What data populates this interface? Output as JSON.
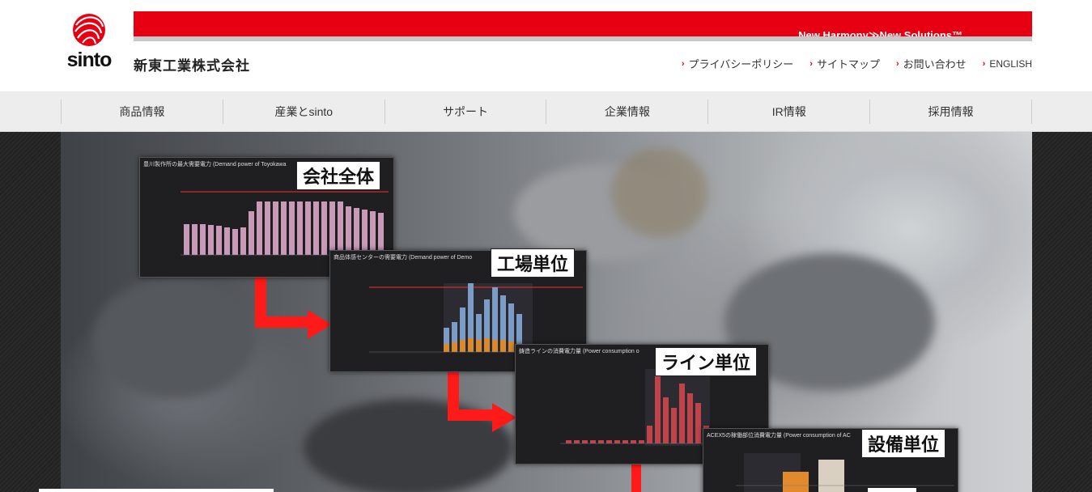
{
  "header": {
    "logo_text": "sinto",
    "company_name": "新東工業株式会社",
    "tagline": "New Harmony≫New Solutions™",
    "links": [
      {
        "label": "プライバシーポリシー"
      },
      {
        "label": "サイトマップ"
      },
      {
        "label": "お問い合わせ"
      },
      {
        "label": "ENGLISH"
      }
    ]
  },
  "nav": {
    "items": [
      {
        "label": "商品情報"
      },
      {
        "label": "産業とsinto"
      },
      {
        "label": "サポート"
      },
      {
        "label": "企業情報"
      },
      {
        "label": "IR情報"
      },
      {
        "label": "採用情報"
      }
    ]
  },
  "hero": {
    "panels": [
      {
        "title": "豊川製作所の最大需要電力 (Demand power of Toyokawa",
        "label": "会社全体"
      },
      {
        "title": "商品体感センターの需要電力 (Demand power of Demo",
        "label": "工場単位"
      },
      {
        "title": "鋳造ラインの消費電力量 (Power consumption o",
        "label": "ライン単位"
      },
      {
        "title": "ACEX5の稼働部位消費電力量 (Power consumption of AC",
        "label": "設備単位"
      }
    ]
  },
  "colors": {
    "brand_red": "#e60012"
  }
}
